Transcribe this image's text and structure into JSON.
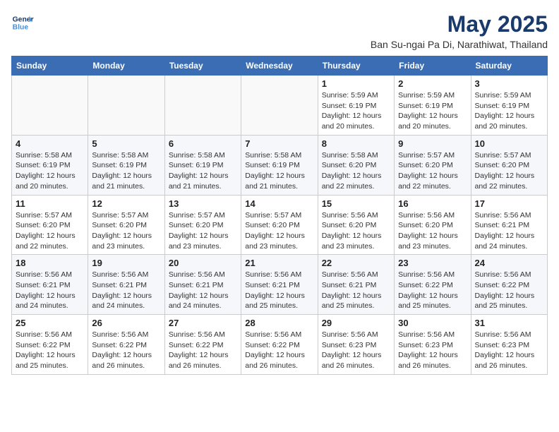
{
  "logo": {
    "line1": "General",
    "line2": "Blue"
  },
  "title": "May 2025",
  "subtitle": "Ban Su-ngai Pa Di, Narathiwat, Thailand",
  "weekdays": [
    "Sunday",
    "Monday",
    "Tuesday",
    "Wednesday",
    "Thursday",
    "Friday",
    "Saturday"
  ],
  "weeks": [
    [
      {
        "day": "",
        "info": ""
      },
      {
        "day": "",
        "info": ""
      },
      {
        "day": "",
        "info": ""
      },
      {
        "day": "",
        "info": ""
      },
      {
        "day": "1",
        "info": "Sunrise: 5:59 AM\nSunset: 6:19 PM\nDaylight: 12 hours\nand 20 minutes."
      },
      {
        "day": "2",
        "info": "Sunrise: 5:59 AM\nSunset: 6:19 PM\nDaylight: 12 hours\nand 20 minutes."
      },
      {
        "day": "3",
        "info": "Sunrise: 5:59 AM\nSunset: 6:19 PM\nDaylight: 12 hours\nand 20 minutes."
      }
    ],
    [
      {
        "day": "4",
        "info": "Sunrise: 5:58 AM\nSunset: 6:19 PM\nDaylight: 12 hours\nand 20 minutes."
      },
      {
        "day": "5",
        "info": "Sunrise: 5:58 AM\nSunset: 6:19 PM\nDaylight: 12 hours\nand 21 minutes."
      },
      {
        "day": "6",
        "info": "Sunrise: 5:58 AM\nSunset: 6:19 PM\nDaylight: 12 hours\nand 21 minutes."
      },
      {
        "day": "7",
        "info": "Sunrise: 5:58 AM\nSunset: 6:19 PM\nDaylight: 12 hours\nand 21 minutes."
      },
      {
        "day": "8",
        "info": "Sunrise: 5:58 AM\nSunset: 6:20 PM\nDaylight: 12 hours\nand 22 minutes."
      },
      {
        "day": "9",
        "info": "Sunrise: 5:57 AM\nSunset: 6:20 PM\nDaylight: 12 hours\nand 22 minutes."
      },
      {
        "day": "10",
        "info": "Sunrise: 5:57 AM\nSunset: 6:20 PM\nDaylight: 12 hours\nand 22 minutes."
      }
    ],
    [
      {
        "day": "11",
        "info": "Sunrise: 5:57 AM\nSunset: 6:20 PM\nDaylight: 12 hours\nand 22 minutes."
      },
      {
        "day": "12",
        "info": "Sunrise: 5:57 AM\nSunset: 6:20 PM\nDaylight: 12 hours\nand 23 minutes."
      },
      {
        "day": "13",
        "info": "Sunrise: 5:57 AM\nSunset: 6:20 PM\nDaylight: 12 hours\nand 23 minutes."
      },
      {
        "day": "14",
        "info": "Sunrise: 5:57 AM\nSunset: 6:20 PM\nDaylight: 12 hours\nand 23 minutes."
      },
      {
        "day": "15",
        "info": "Sunrise: 5:56 AM\nSunset: 6:20 PM\nDaylight: 12 hours\nand 23 minutes."
      },
      {
        "day": "16",
        "info": "Sunrise: 5:56 AM\nSunset: 6:20 PM\nDaylight: 12 hours\nand 23 minutes."
      },
      {
        "day": "17",
        "info": "Sunrise: 5:56 AM\nSunset: 6:21 PM\nDaylight: 12 hours\nand 24 minutes."
      }
    ],
    [
      {
        "day": "18",
        "info": "Sunrise: 5:56 AM\nSunset: 6:21 PM\nDaylight: 12 hours\nand 24 minutes."
      },
      {
        "day": "19",
        "info": "Sunrise: 5:56 AM\nSunset: 6:21 PM\nDaylight: 12 hours\nand 24 minutes."
      },
      {
        "day": "20",
        "info": "Sunrise: 5:56 AM\nSunset: 6:21 PM\nDaylight: 12 hours\nand 24 minutes."
      },
      {
        "day": "21",
        "info": "Sunrise: 5:56 AM\nSunset: 6:21 PM\nDaylight: 12 hours\nand 25 minutes."
      },
      {
        "day": "22",
        "info": "Sunrise: 5:56 AM\nSunset: 6:21 PM\nDaylight: 12 hours\nand 25 minutes."
      },
      {
        "day": "23",
        "info": "Sunrise: 5:56 AM\nSunset: 6:22 PM\nDaylight: 12 hours\nand 25 minutes."
      },
      {
        "day": "24",
        "info": "Sunrise: 5:56 AM\nSunset: 6:22 PM\nDaylight: 12 hours\nand 25 minutes."
      }
    ],
    [
      {
        "day": "25",
        "info": "Sunrise: 5:56 AM\nSunset: 6:22 PM\nDaylight: 12 hours\nand 25 minutes."
      },
      {
        "day": "26",
        "info": "Sunrise: 5:56 AM\nSunset: 6:22 PM\nDaylight: 12 hours\nand 26 minutes."
      },
      {
        "day": "27",
        "info": "Sunrise: 5:56 AM\nSunset: 6:22 PM\nDaylight: 12 hours\nand 26 minutes."
      },
      {
        "day": "28",
        "info": "Sunrise: 5:56 AM\nSunset: 6:22 PM\nDaylight: 12 hours\nand 26 minutes."
      },
      {
        "day": "29",
        "info": "Sunrise: 5:56 AM\nSunset: 6:23 PM\nDaylight: 12 hours\nand 26 minutes."
      },
      {
        "day": "30",
        "info": "Sunrise: 5:56 AM\nSunset: 6:23 PM\nDaylight: 12 hours\nand 26 minutes."
      },
      {
        "day": "31",
        "info": "Sunrise: 5:56 AM\nSunset: 6:23 PM\nDaylight: 12 hours\nand 26 minutes."
      }
    ]
  ]
}
